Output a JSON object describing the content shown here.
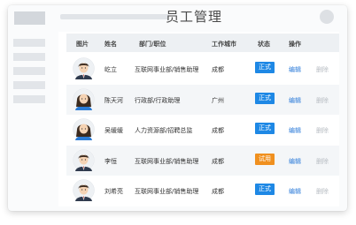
{
  "page": {
    "title": "员工管理"
  },
  "table": {
    "headers": [
      "图片",
      "姓名",
      "部门/职位",
      "工作城市",
      "状态",
      "操作"
    ],
    "rows": [
      {
        "name": "屹立",
        "department": "互联网事业部/销售助理",
        "city": "成都",
        "status": "正式",
        "edit": "编辑",
        "delete": "删除",
        "avatar": "male"
      },
      {
        "name": "陈天河",
        "department": "行政部/行政助理",
        "city": "广州",
        "status": "正式",
        "edit": "编辑",
        "delete": "删除",
        "avatar": "female"
      },
      {
        "name": "吴缓缓",
        "department": "人力资源部/招聘总监",
        "city": "成都",
        "status": "正式",
        "edit": "编辑",
        "delete": "删除",
        "avatar": "female"
      },
      {
        "name": "李恒",
        "department": "互联网事业部/销售助理",
        "city": "成都",
        "status": "试用",
        "edit": "编辑",
        "delete": "删除",
        "avatar": "male"
      },
      {
        "name": "刘希亮",
        "department": "互联网事业部/销售助理",
        "city": "成都",
        "status": "正式",
        "edit": "编辑",
        "delete": "删除",
        "avatar": "male"
      }
    ]
  },
  "colors": {
    "formal": "#1e88e5",
    "trial": "#f0901f",
    "link": "#2a7ad9"
  },
  "icons": {
    "male_avatar": "male-avatar-icon",
    "female_avatar": "female-avatar-icon"
  }
}
